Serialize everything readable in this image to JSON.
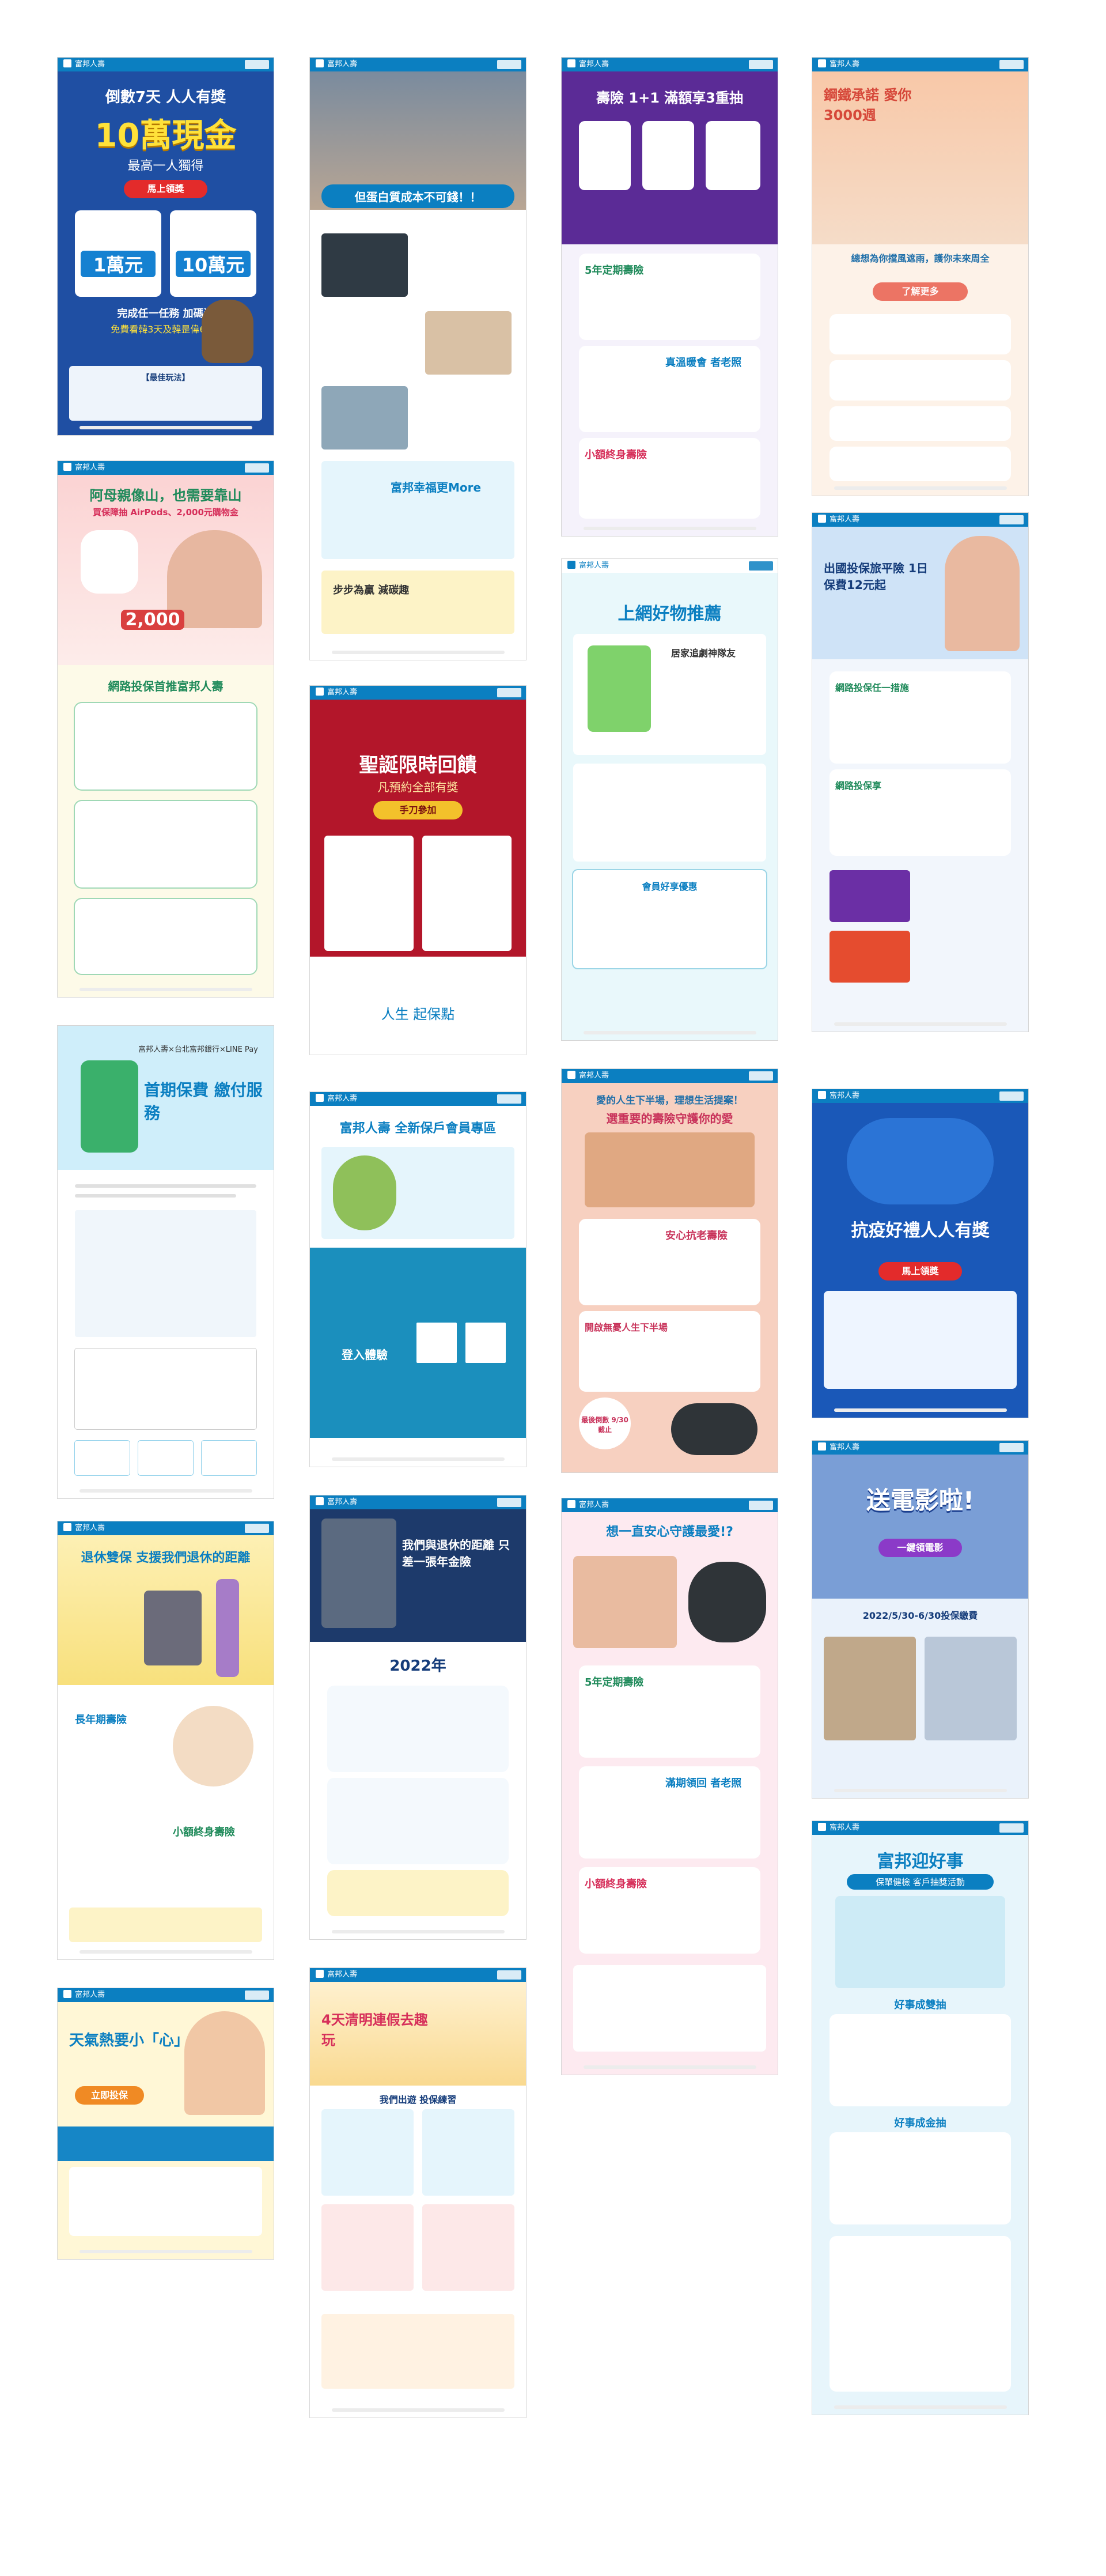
{
  "brand": {
    "name": "富邦人壽"
  },
  "colors": {
    "brand_blue": "#0b7fc1",
    "navy": "#153c7a",
    "red": "#c81e1e",
    "gold": "#f3c12b",
    "teal": "#17a5a5",
    "pink": "#f9c4c4",
    "sky": "#aee0f5"
  },
  "cards": {
    "c1": {
      "title": "10萬現金",
      "pre": "倒數7天 人人有獎",
      "sub": "最高一人獨得",
      "cta": "馬上領獎",
      "a": "1萬元",
      "b": "10萬元",
      "note": "完成任一任務 加碼送",
      "note2": "免費看韓3天及韓昰偉60天",
      "rules": "【最佳玩法】"
    },
    "c2": {
      "banner": "但蛋白質成本不可錢！！",
      "q": "富邦幸福更More",
      "tag": "步步為贏 減碳趣"
    },
    "c3": {
      "title": "壽險 1+1 滿額享3重抽",
      "s1": "5年定期壽險",
      "s2": "真溫暖會 者老照",
      "s3": "小額終身壽險"
    },
    "c4": {
      "title": "鋼鐵承諾 愛你3000週",
      "sub": "總想為你擋風遮雨，護你未來周全",
      "cta": "了解更多"
    },
    "c5": {
      "title": "阿母親像山，也需要靠山",
      "sub": "買保障抽 AirPods、2,000元購物金",
      "amount": "2,000",
      "section": "網路投保首推富邦人壽"
    },
    "c6": {
      "title": "聖誕限時回饋",
      "sub": "凡預約全部有獎",
      "cta": "手刀參加",
      "foot": "人生 起保點"
    },
    "c7": {
      "title": "上網好物推薦",
      "sub": "居家追劇神隊友",
      "sec": "會員好享優惠"
    },
    "c8": {
      "title": "出國投保旅平險 1日保費12元起",
      "sec": "網路投保任一措施",
      "sec2": "網路投保享",
      "cta": ""
    },
    "c9": {
      "title": "首期保費 繳付服務",
      "sub": "富邦人壽×台北富邦銀行×LINE Pay"
    },
    "c10": {
      "title": "富邦人壽 全新保戶會員專區",
      "cta": "登入體驗"
    },
    "c11": {
      "title": "愛的人生下半場，理想生活提案！",
      "sub": "選重要的壽險守護你的愛",
      "s1": "安心抗老壽險",
      "s2": "開啟無憂人生下半場",
      "count": "最後倒數 9/30截止"
    },
    "c12": {
      "title": "抗疫好禮人人有獎",
      "cta": "馬上領獎"
    },
    "c13": {
      "title": "退休雙保 支援我們退休的距離",
      "s1": "長年期壽險",
      "s2": "小額終身壽險"
    },
    "c14": {
      "title": "我們與退休的距離 只差一張年金險",
      "year": "2022年"
    },
    "c15": {
      "title": "想一直安心守護最愛!?",
      "s1": "5年定期壽險",
      "s2": "滿期領回 者老照",
      "s3": "小額終身壽險"
    },
    "c16": {
      "title": "送電影啦!",
      "sub": "2022/5/30-6/30投保繳費",
      "cta": "一鍵領電影"
    },
    "c17": {
      "title": "天氣熱要小「心」",
      "cta": "立即投保"
    },
    "c18": {
      "title": "4天清明連假去趣玩",
      "sec": "我們出遊 投保練習"
    },
    "c19": {
      "title": "富邦迎好事",
      "sub": "保單健檢 客戶抽獎活動",
      "sec": "好事成雙抽",
      "sec2": "好事成金抽"
    }
  }
}
